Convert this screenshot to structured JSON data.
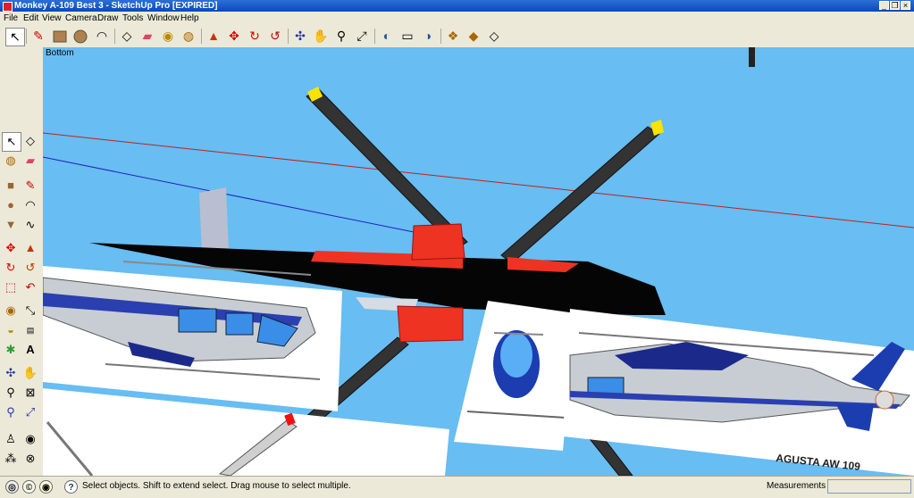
{
  "window": {
    "title": "Monkey A-109 Best 3 - SketchUp Pro [EXPIRED]"
  },
  "menu": [
    "File",
    "Edit",
    "View",
    "Camera",
    "Draw",
    "Tools",
    "Window",
    "Help"
  ],
  "viewport": {
    "label": "Bottom",
    "image_text": "AGUSTA AW 109"
  },
  "status": {
    "message": "Select objects. Shift to extend select. Drag mouse to select multiple.",
    "measurements_label": "Measurements",
    "measurements_value": ""
  },
  "icons": {
    "toolbar": [
      "select",
      "line",
      "rectangle",
      "circle",
      "arc",
      "make-component",
      "eraser",
      "tape-measure",
      "paint-bucket",
      "push-pull",
      "move",
      "rotate",
      "follow-me",
      "orbit",
      "pan",
      "zoom",
      "zoom-extents",
      "get-models",
      "share-model",
      "share-component",
      "photo-textures",
      "section-plane",
      "3d-text"
    ]
  },
  "colors": {
    "viewport_bg": "#68bdf2",
    "title_bar": "#1b5ccb",
    "rotor_red": "#ee3322"
  }
}
